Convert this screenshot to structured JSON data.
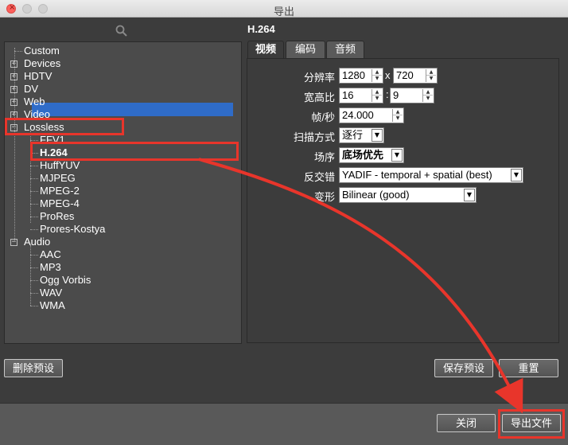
{
  "window": {
    "title": "导出"
  },
  "colors": {
    "accent": "#2f6cc8",
    "highlight": "#e8352b"
  },
  "tree": {
    "items": [
      {
        "label": "Custom",
        "level": 0,
        "expander": ""
      },
      {
        "label": "Devices",
        "level": 0,
        "expander": "+"
      },
      {
        "label": "HDTV",
        "level": 0,
        "expander": "+"
      },
      {
        "label": "DV",
        "level": 0,
        "expander": "+"
      },
      {
        "label": "Web",
        "level": 0,
        "expander": "+"
      },
      {
        "label": "Video",
        "level": 0,
        "expander": "+"
      },
      {
        "label": "Lossless",
        "level": 0,
        "expander": "−"
      },
      {
        "label": "FFV1",
        "level": 1
      },
      {
        "label": "H.264",
        "level": 1,
        "selected": true
      },
      {
        "label": "HuffYUV",
        "level": 1
      },
      {
        "label": "MJPEG",
        "level": 1
      },
      {
        "label": "MPEG-2",
        "level": 1
      },
      {
        "label": "MPEG-4",
        "level": 1
      },
      {
        "label": "ProRes",
        "level": 1
      },
      {
        "label": "Prores-Kostya",
        "level": 1
      },
      {
        "label": "Audio",
        "level": 0,
        "expander": "−"
      },
      {
        "label": "AAC",
        "level": 1
      },
      {
        "label": "MP3",
        "level": 1
      },
      {
        "label": "Ogg Vorbis",
        "level": 1
      },
      {
        "label": "WAV",
        "level": 1
      },
      {
        "label": "WMA",
        "level": 1
      }
    ]
  },
  "preset": {
    "name": "H.264"
  },
  "tabs": [
    {
      "label": "视频"
    },
    {
      "label": "编码"
    },
    {
      "label": "音频"
    }
  ],
  "video": {
    "resolution_label": "分辨率",
    "width": "1280",
    "height": "720",
    "res_sep": "x",
    "aspect_label": "宽高比",
    "aspect_w": "16",
    "aspect_h": "9",
    "aspect_sep": ":",
    "fps_label": "帧/秒",
    "fps": "24.000",
    "scan_label": "扫描方式",
    "scan": "逐行",
    "field_label": "场序",
    "field": "底场优先",
    "deinterlace_label": "反交错",
    "deinterlace": "YADIF - temporal + spatial (best)",
    "resize_label": "变形",
    "resize": "Bilinear (good)"
  },
  "buttons": {
    "delete_preset": "删除预设",
    "save_preset": "保存预设",
    "reset": "重置",
    "close": "关闭",
    "export_file": "导出文件"
  },
  "icons": {
    "search": "search-icon",
    "spin_up": "▲",
    "spin_down": "▼",
    "combo_arrow": "▼"
  }
}
